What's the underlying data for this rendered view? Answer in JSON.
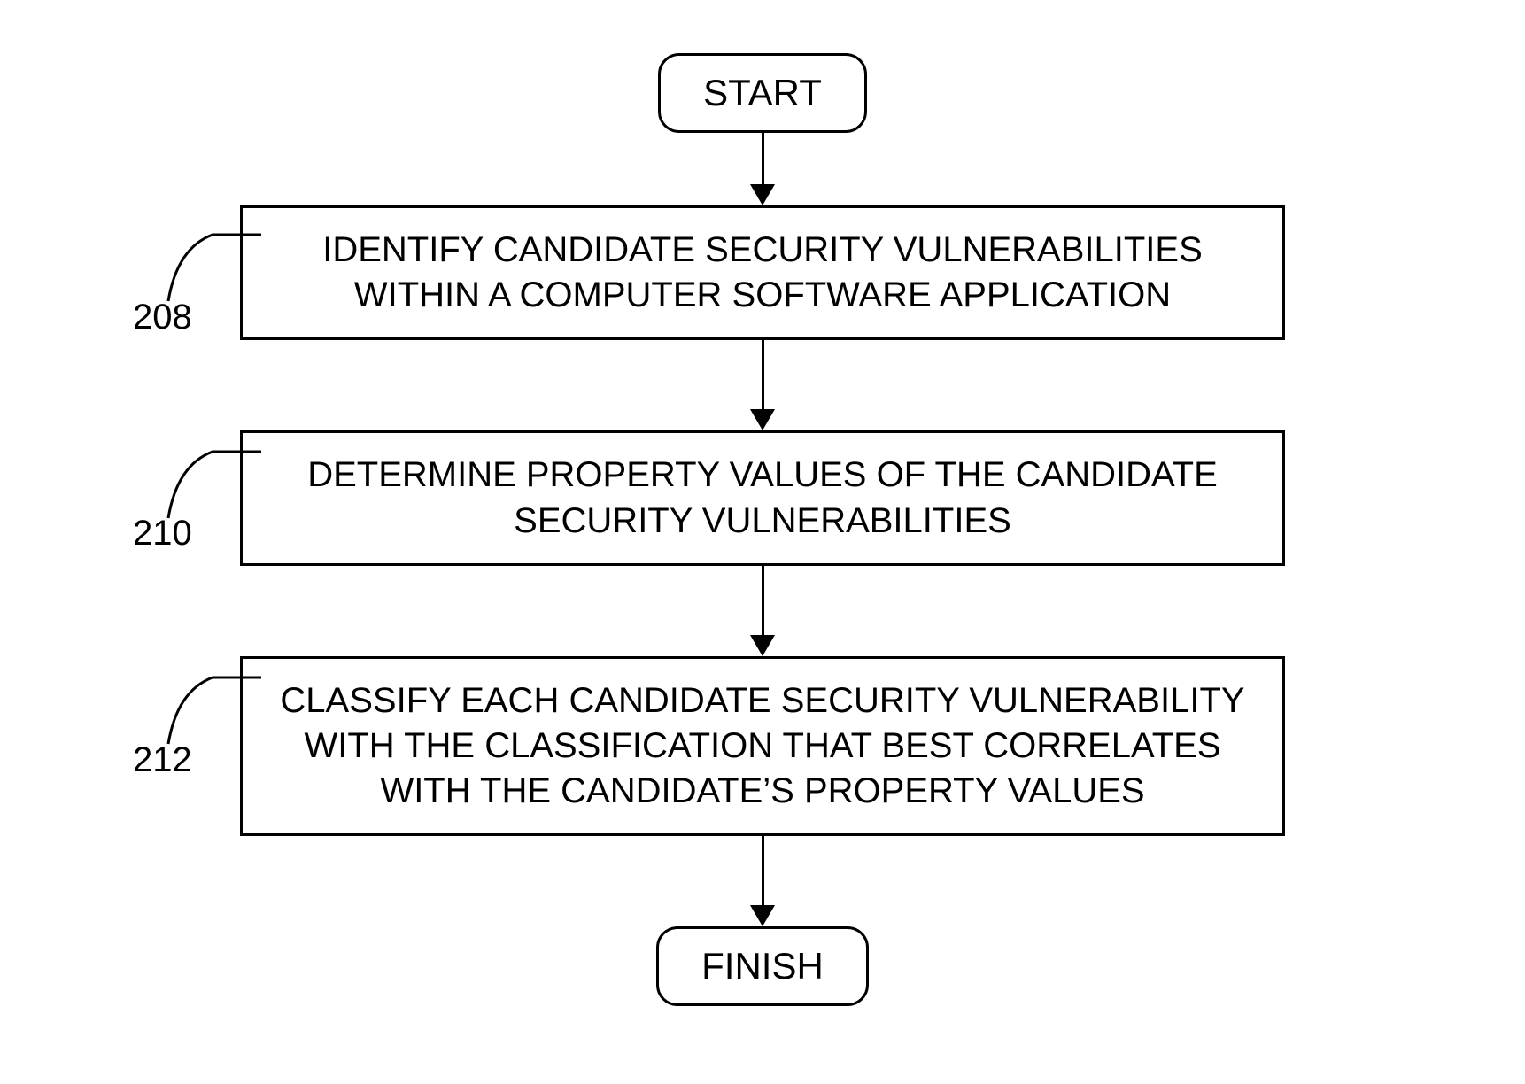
{
  "flowchart": {
    "start_label": "START",
    "finish_label": "FINISH",
    "steps": [
      {
        "ref": "208",
        "text": "IDENTIFY CANDIDATE SECURITY VULNERABILITIES WITHIN A COMPUTER SOFTWARE APPLICATION"
      },
      {
        "ref": "210",
        "text": "DETERMINE PROPERTY VALUES OF THE CANDIDATE SECURITY VULNERABILITIES"
      },
      {
        "ref": "212",
        "text": "CLASSIFY EACH CANDIDATE SECURITY VULNERABILITY WITH THE CLASSIFICATION THAT BEST CORRELATES WITH THE CANDIDATE’S PROPERTY VALUES"
      }
    ]
  }
}
